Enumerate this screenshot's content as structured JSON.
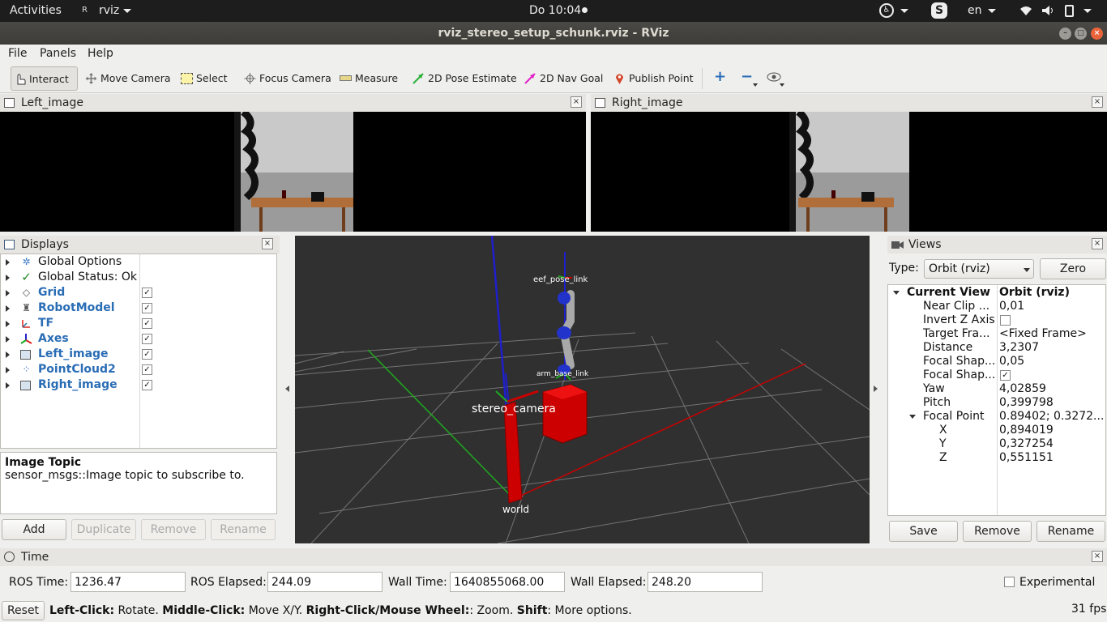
{
  "topbar": {
    "activities": "Activities",
    "app_name": "rviz",
    "clock": "Do 10:04",
    "language": "en",
    "skype_letter": "S"
  },
  "window": {
    "title": "rviz_stereo_setup_schunk.rviz - RViz"
  },
  "menu": {
    "file": "File",
    "panels": "Panels",
    "help": "Help"
  },
  "toolbar": {
    "interact": "Interact",
    "move_camera": "Move Camera",
    "select": "Select",
    "focus_camera": "Focus Camera",
    "measure": "Measure",
    "pose_estimate": "2D Pose Estimate",
    "nav_goal": "2D Nav Goal",
    "publish_point": "Publish Point"
  },
  "left_image": {
    "title": "Left_image"
  },
  "right_image": {
    "title": "Right_image"
  },
  "displays": {
    "title": "Displays",
    "items": [
      {
        "label": "Global Options",
        "checked": null
      },
      {
        "label": "Global Status: Ok",
        "checked": null
      },
      {
        "label": "Grid",
        "checked": true
      },
      {
        "label": "RobotModel",
        "checked": true
      },
      {
        "label": "TF",
        "checked": true
      },
      {
        "label": "Axes",
        "checked": true
      },
      {
        "label": "Left_image",
        "checked": true
      },
      {
        "label": "PointCloud2",
        "checked": true
      },
      {
        "label": "Right_image",
        "checked": true
      }
    ],
    "desc_title": "Image Topic",
    "desc_text": "sensor_msgs::Image topic to subscribe to.",
    "buttons": {
      "add": "Add",
      "duplicate": "Duplicate",
      "remove": "Remove",
      "rename": "Rename"
    }
  },
  "viewport": {
    "labels": {
      "eef": "eef_pose_link",
      "arm_base": "arm_base_link",
      "stereo": "stereo_camera",
      "world": "world"
    }
  },
  "views": {
    "title": "Views",
    "type_label": "Type:",
    "type_value": "Orbit (rviz)",
    "zero": "Zero",
    "current_view_key": "Current View",
    "current_view_value": "Orbit (rviz)",
    "props": [
      {
        "k": "Near Clip ...",
        "v": "0,01"
      },
      {
        "k": "Invert Z Axis",
        "v": ""
      },
      {
        "k": "Target Fra...",
        "v": "<Fixed Frame>"
      },
      {
        "k": "Distance",
        "v": "3,2307"
      },
      {
        "k": "Focal Shap...",
        "v": "0,05"
      },
      {
        "k": "Focal Shap...",
        "v": ""
      },
      {
        "k": "Yaw",
        "v": "4,02859"
      },
      {
        "k": "Pitch",
        "v": "0,399798"
      }
    ],
    "focal_point_key": "Focal Point",
    "focal_point_value": "0.89402; 0.3272...",
    "focal": [
      {
        "k": "X",
        "v": "0,894019"
      },
      {
        "k": "Y",
        "v": "0,327254"
      },
      {
        "k": "Z",
        "v": "0,551151"
      }
    ],
    "buttons": {
      "save": "Save",
      "remove": "Remove",
      "rename": "Rename"
    }
  },
  "time": {
    "title": "Time",
    "ros_time_label": "ROS Time:",
    "ros_time": "1236.47",
    "ros_elapsed_label": "ROS Elapsed:",
    "ros_elapsed": "244.09",
    "wall_time_label": "Wall Time:",
    "wall_time": "1640855068.00",
    "wall_elapsed_label": "Wall Elapsed:",
    "wall_elapsed": "248.20",
    "experimental": "Experimental"
  },
  "statusbar": {
    "reset": "Reset",
    "left_click_b": "Left-Click:",
    "left_click": " Rotate. ",
    "middle_click_b": "Middle-Click:",
    "middle_click": " Move X/Y. ",
    "right_click_b": "Right-Click/Mouse Wheel:",
    "right_click": ": Zoom. ",
    "shift_b": "Shift",
    "shift": ": More options.",
    "fps": "31 fps"
  }
}
